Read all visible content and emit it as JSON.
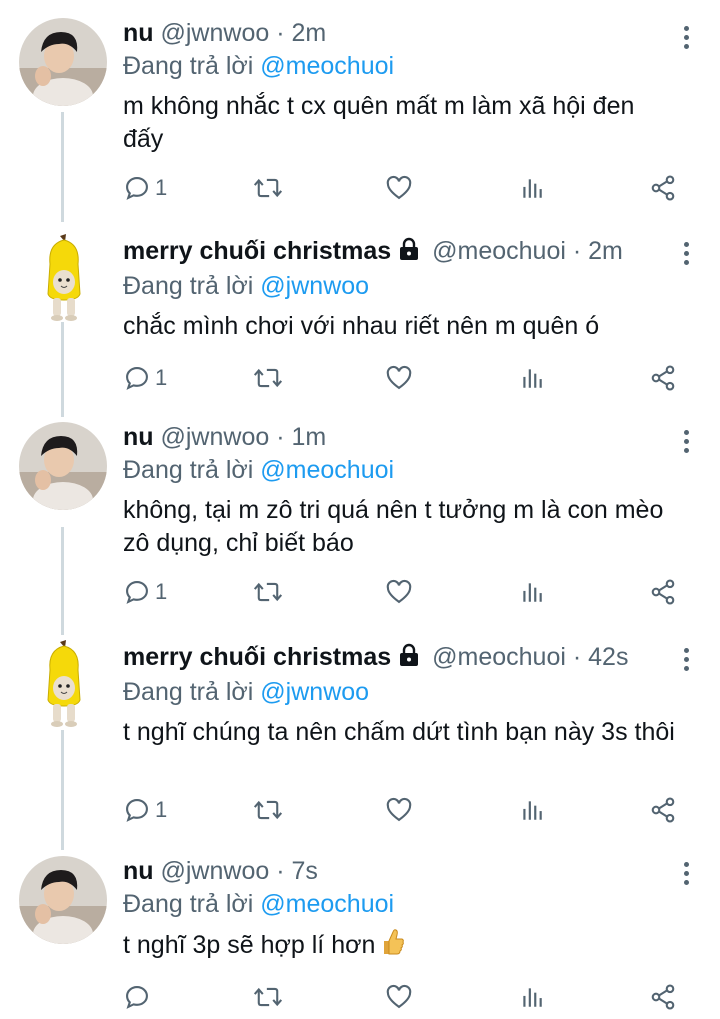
{
  "ui": {
    "reply_prefix": "Đang trả lời"
  },
  "tweets": [
    {
      "name": "nu",
      "handle": "@jwnwoo",
      "sep": "·",
      "time": "2m",
      "reply_to": "@meochuoi",
      "text": "m không nhắc t cx quên mất m làm xã hội đen đấy",
      "reply_count": "1"
    },
    {
      "name": "merry chuối christmas",
      "handle": "@meochuoi",
      "sep": "·",
      "time": "2m",
      "reply_to": "@jwnwoo",
      "text": "chắc mình chơi với nhau riết nên m quên ó",
      "reply_count": "1"
    },
    {
      "name": "nu",
      "handle": "@jwnwoo",
      "sep": "·",
      "time": "1m",
      "reply_to": "@meochuoi",
      "text": "không, tại m zô tri quá nên t tưởng m là con mèo zô dụng, chỉ biết báo",
      "reply_count": "1"
    },
    {
      "name": "merry chuối christmas",
      "handle": "@meochuoi",
      "sep": "·",
      "time": "42s",
      "reply_to": "@jwnwoo",
      "text": "t nghĩ chúng ta nên chấm dứt tình bạn này 3s thôi",
      "reply_count": "1"
    },
    {
      "name": "nu",
      "handle": "@jwnwoo",
      "sep": "·",
      "time": "7s",
      "reply_to": "@meochuoi",
      "text": "t nghĩ 3p sẽ hợp lí hơn",
      "reply_count": ""
    }
  ],
  "icons": {
    "reply": "reply-icon",
    "retweet": "retweet-icon",
    "like": "heart-icon",
    "views": "views-icon",
    "share": "share-icon",
    "more": "more-icon",
    "lock": "lock-icon",
    "thumb": "thumbs-up-emoji"
  },
  "colors": {
    "mention": "#1d9bf0",
    "muted": "#536471",
    "text": "#0f1419",
    "thread_line": "#cfd9de"
  }
}
